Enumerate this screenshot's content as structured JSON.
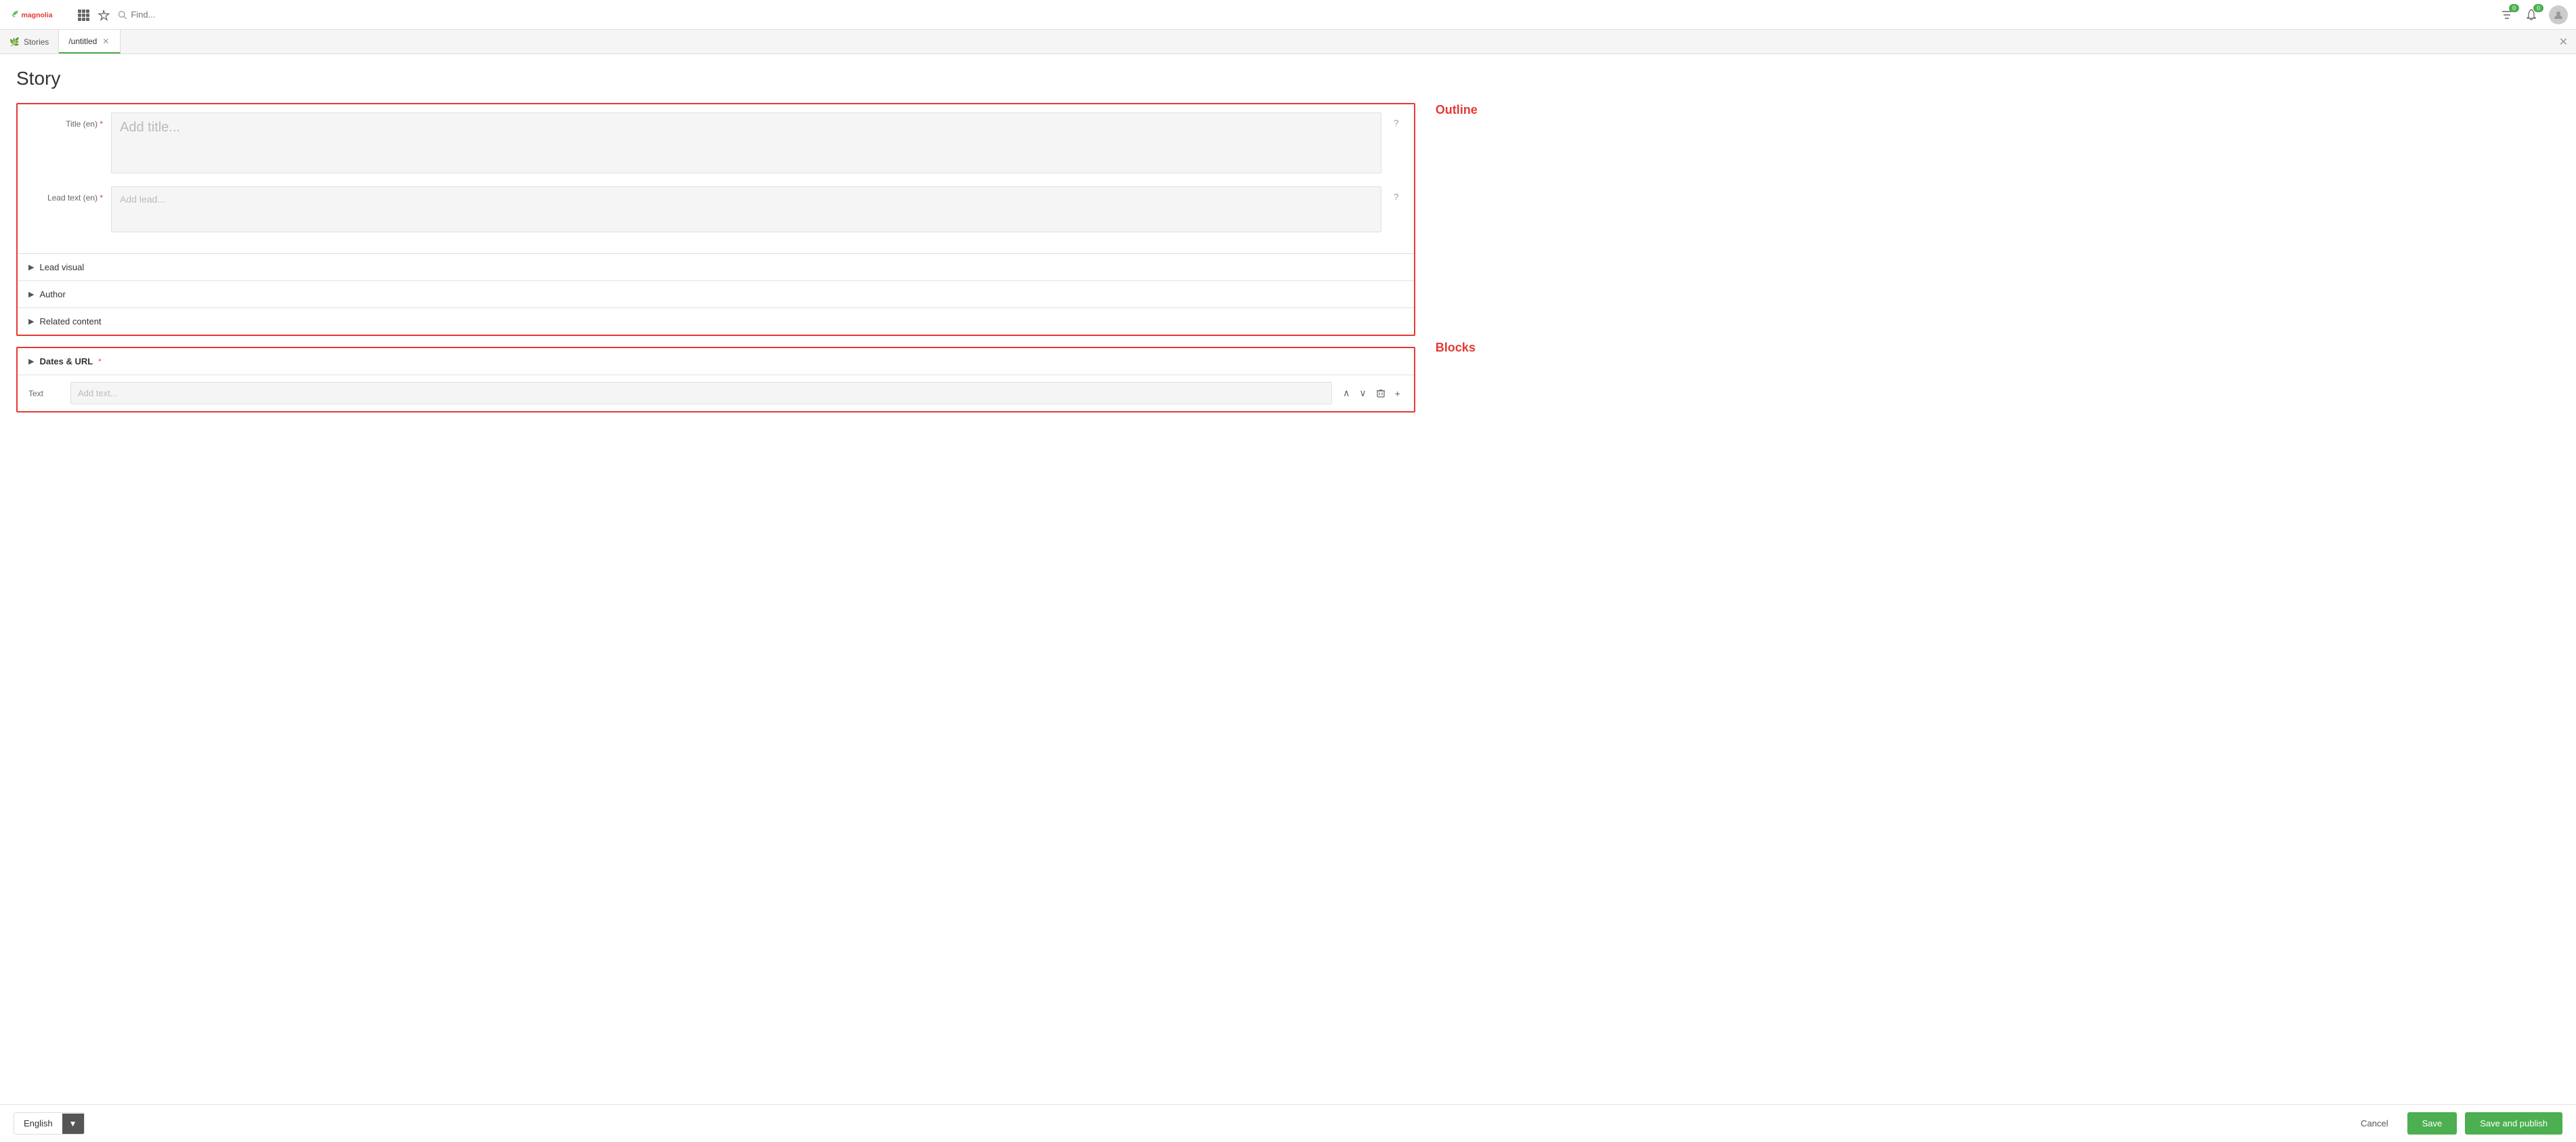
{
  "app": {
    "name": "Magnolia"
  },
  "topnav": {
    "search_placeholder": "Find...",
    "filter_badge": "0",
    "bell_badge": "0"
  },
  "tabs": [
    {
      "id": "stories",
      "label": "Stories",
      "active": false,
      "closable": false,
      "icon": "leaf"
    },
    {
      "id": "untitled",
      "label": "/untitled",
      "active": true,
      "closable": true,
      "icon": null
    }
  ],
  "page": {
    "title": "Story"
  },
  "outline": {
    "label": "Outline",
    "fields": {
      "title": {
        "label": "Title (en)",
        "required": true,
        "placeholder": "Add title...",
        "help": "?"
      },
      "lead_text": {
        "label": "Lead text (en)",
        "required": true,
        "placeholder": "Add lead...",
        "help": "?"
      }
    },
    "collapsibles": [
      {
        "id": "lead_visual",
        "label": "Lead visual"
      },
      {
        "id": "author",
        "label": "Author"
      },
      {
        "id": "related_content",
        "label": "Related content"
      }
    ]
  },
  "blocks": {
    "label": "Blocks",
    "dates_section": {
      "label": "Dates & URL",
      "required": true
    },
    "text_block": {
      "label": "Text",
      "placeholder": "Add text..."
    },
    "actions": {
      "up": "↑",
      "down": "↓",
      "delete": "🗑",
      "add": "+"
    }
  },
  "bottom": {
    "language": {
      "label": "English",
      "dropdown_icon": "▼"
    },
    "cancel_label": "Cancel",
    "save_label": "Save",
    "save_publish_label": "Save and publish"
  }
}
